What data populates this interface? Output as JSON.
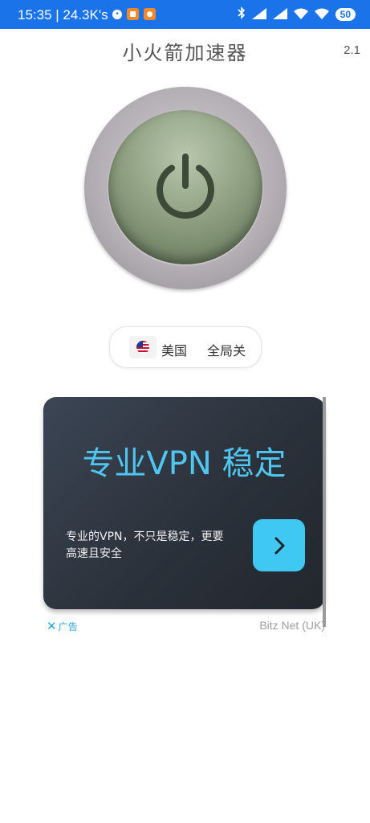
{
  "status_bar": {
    "time": "15:35 | 24.3K's",
    "battery": "50",
    "colors": {
      "background": "#1a73e8"
    },
    "icons": [
      "face-icon",
      "app-icon-1",
      "app-icon-2",
      "bluetooth-icon",
      "signal-hd-icon",
      "signal-hd-icon",
      "wifi-icon",
      "wifi-icon",
      "battery-icon"
    ]
  },
  "header": {
    "title": "小火箭加速器",
    "version": "2.1"
  },
  "power_button": {
    "icon": "power-icon"
  },
  "region": {
    "flag_icon": "us-flag-icon",
    "country": "美国",
    "mode": "全局关"
  },
  "ad": {
    "headline": "专业VPN 稳定",
    "body": "专业的VPN，不只是稳定，更要高速且安全",
    "cta_icon": "chevron-right-icon",
    "close_glyph": "✕",
    "tag": "广告",
    "advertiser": "Bitz Net (UK)",
    "colors": {
      "headline": "#4ec6ef",
      "button": "#3fc8f1"
    }
  }
}
